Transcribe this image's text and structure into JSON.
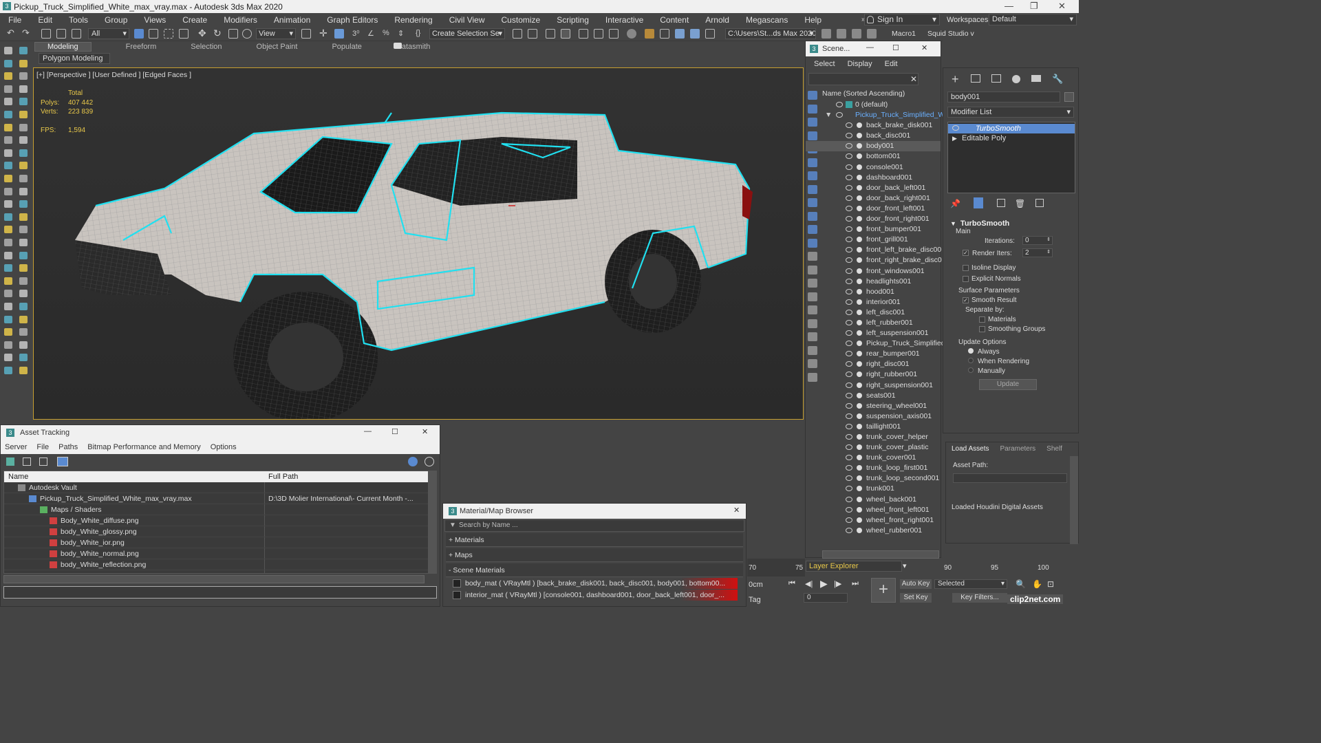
{
  "title": "Pickup_Truck_Simplified_White_max_vray.max - Autodesk 3ds Max 2020",
  "menu": [
    "File",
    "Edit",
    "Tools",
    "Group",
    "Views",
    "Create",
    "Modifiers",
    "Animation",
    "Graph Editors",
    "Rendering",
    "Civil View",
    "Customize",
    "Scripting",
    "Interactive",
    "Content",
    "Arnold",
    "Megascans",
    "Help"
  ],
  "sign_in": "Sign In",
  "workspaces_label": "Workspaces:",
  "workspace_value": "Default",
  "toolbar": {
    "filter": "All",
    "view": "View",
    "selection_set": "Create Selection Se",
    "path": "C:\\Users\\St...ds Max 2020",
    "macro": "Macro1",
    "squid": "Squid Studio v"
  },
  "ribbon_tabs": [
    "Modeling",
    "Freeform",
    "Selection",
    "Object Paint",
    "Populate",
    "Datasmith"
  ],
  "ribbon_sub": "Polygon Modeling",
  "viewport": {
    "label": "[+] [Perspective ] [User Defined ] [Edged Faces ]",
    "stats_total": "Total",
    "polys_label": "Polys:",
    "polys": "407 442",
    "verts_label": "Verts:",
    "verts": "223 839",
    "fps_label": "FPS:",
    "fps": "1,594"
  },
  "scene": {
    "title": "Scene...",
    "menu": [
      "Select",
      "Display",
      "Edit"
    ],
    "column": "Name (Sorted Ascending)",
    "layer": "0 (default)",
    "group": "Pickup_Truck_Simplified_Wh",
    "items": [
      "back_brake_disk001",
      "back_disc001",
      "body001",
      "bottom001",
      "console001",
      "dashboard001",
      "door_back_left001",
      "door_back_right001",
      "door_front_left001",
      "door_front_right001",
      "front_bumper001",
      "front_grill001",
      "front_left_brake_disc00",
      "front_right_brake_disc0",
      "front_windows001",
      "headlights001",
      "hood001",
      "interior001",
      "left_disc001",
      "left_rubber001",
      "left_suspension001",
      "Pickup_Truck_Simplified",
      "rear_bumper001",
      "right_disc001",
      "right_rubber001",
      "right_suspension001",
      "seats001",
      "steering_wheel001",
      "suspension_axis001",
      "taillight001",
      "trunk_cover_helper",
      "trunk_cover_plastic",
      "trunk_cover001",
      "trunk_loop_first001",
      "trunk_loop_second001",
      "trunk001",
      "wheel_back001",
      "wheel_front_left001",
      "wheel_front_right001",
      "wheel_rubber001"
    ],
    "footer": "Layer Explorer"
  },
  "modify": {
    "object_name": "body001",
    "modifier_list": "Modifier List",
    "stack": [
      "TurboSmooth",
      "Editable Poly"
    ],
    "rollout_title": "TurboSmooth",
    "main": "Main",
    "iterations_label": "Iterations:",
    "iterations": "0",
    "render_iters_label": "Render Iters:",
    "render_iters": "2",
    "isoline": "Isoline Display",
    "explicit": "Explicit Normals",
    "surface": "Surface Parameters",
    "smooth_result": "Smooth Result",
    "separate_by": "Separate by:",
    "materials": "Materials",
    "smoothing_groups": "Smoothing Groups",
    "update_options": "Update Options",
    "always": "Always",
    "when_rendering": "When Rendering",
    "manually": "Manually",
    "update_btn": "Update"
  },
  "houdini": {
    "tabs": [
      "Load Assets",
      "Parameters",
      "Shelf"
    ],
    "asset_path": "Asset Path:",
    "loaded": "Loaded Houdini Digital Assets"
  },
  "asset_tracking": {
    "title": "Asset Tracking",
    "menu": [
      "Server",
      "File",
      "Paths",
      "Bitmap Performance and Memory",
      "Options"
    ],
    "col_name": "Name",
    "col_path": "Full Path",
    "rows": [
      {
        "name": "Autodesk Vault",
        "path": ""
      },
      {
        "name": "Pickup_Truck_Simplified_White_max_vray.max",
        "path": "D:\\3D Molier International\\- Current Month -..."
      },
      {
        "name": "Maps / Shaders",
        "path": ""
      },
      {
        "name": "Body_White_diffuse.png",
        "path": ""
      },
      {
        "name": "body_White_glossy.png",
        "path": ""
      },
      {
        "name": "body_White_ior.png",
        "path": ""
      },
      {
        "name": "body_White_normal.png",
        "path": ""
      },
      {
        "name": "body_White_reflection.png",
        "path": ""
      }
    ]
  },
  "material_browser": {
    "title": "Material/Map Browser",
    "search": "Search by Name ...",
    "sections": [
      "+ Materials",
      "+ Maps",
      "- Scene Materials"
    ],
    "materials": [
      "body_mat  ( VRayMtl ) [back_brake_disk001, back_disc001, body001, bottom00...",
      "interior_mat  ( VRayMtl ) [console001, dashboard001, door_back_left001, door_..."
    ]
  },
  "timeline": {
    "ticks": [
      "70",
      "75",
      "90",
      "95",
      "100"
    ],
    "unit": "0cm",
    "tag": "Tag",
    "frame": "0",
    "auto_key": "Auto Key",
    "set_key": "Set Key",
    "selected": "Selected",
    "key_filters": "Key Filters..."
  },
  "watermark": "clip2net.com"
}
